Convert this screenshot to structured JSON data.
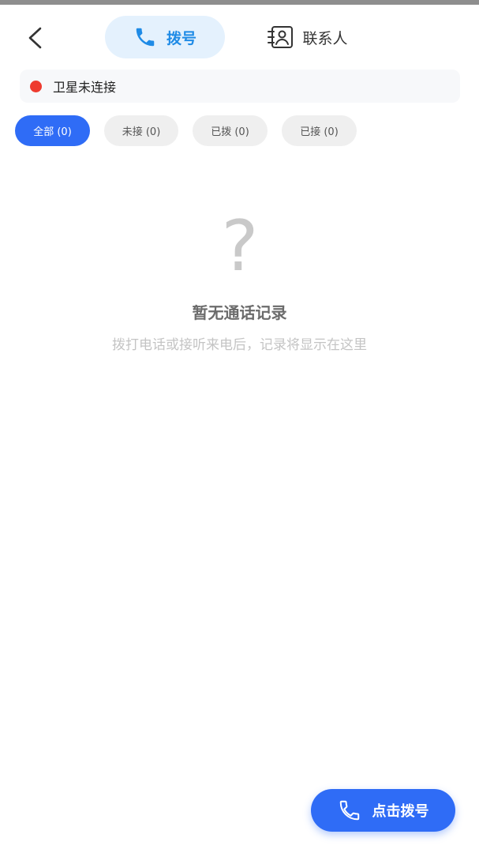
{
  "header": {
    "tabs": [
      {
        "label": "拨号",
        "active": true,
        "icon": "phone-icon"
      },
      {
        "label": "联系人",
        "active": false,
        "icon": "contacts-icon"
      }
    ]
  },
  "satellite": {
    "status_text": "卫星未连接",
    "status_color": "#ee3b2f"
  },
  "filters": [
    {
      "label": "全部 (0)",
      "active": true
    },
    {
      "label": "未接 (0)",
      "active": false
    },
    {
      "label": "已拨 (0)",
      "active": false
    },
    {
      "label": "已接 (0)",
      "active": false
    }
  ],
  "empty_state": {
    "icon": "?",
    "title": "暂无通话记录",
    "subtitle": "拨打电话或接听来电后，记录将显示在这里"
  },
  "fab": {
    "label": "点击拨号",
    "icon": "phone-icon"
  },
  "colors": {
    "accent": "#2f6cf6",
    "tab_accent": "#1f8be6",
    "tab_bg": "#e4f1fd"
  }
}
